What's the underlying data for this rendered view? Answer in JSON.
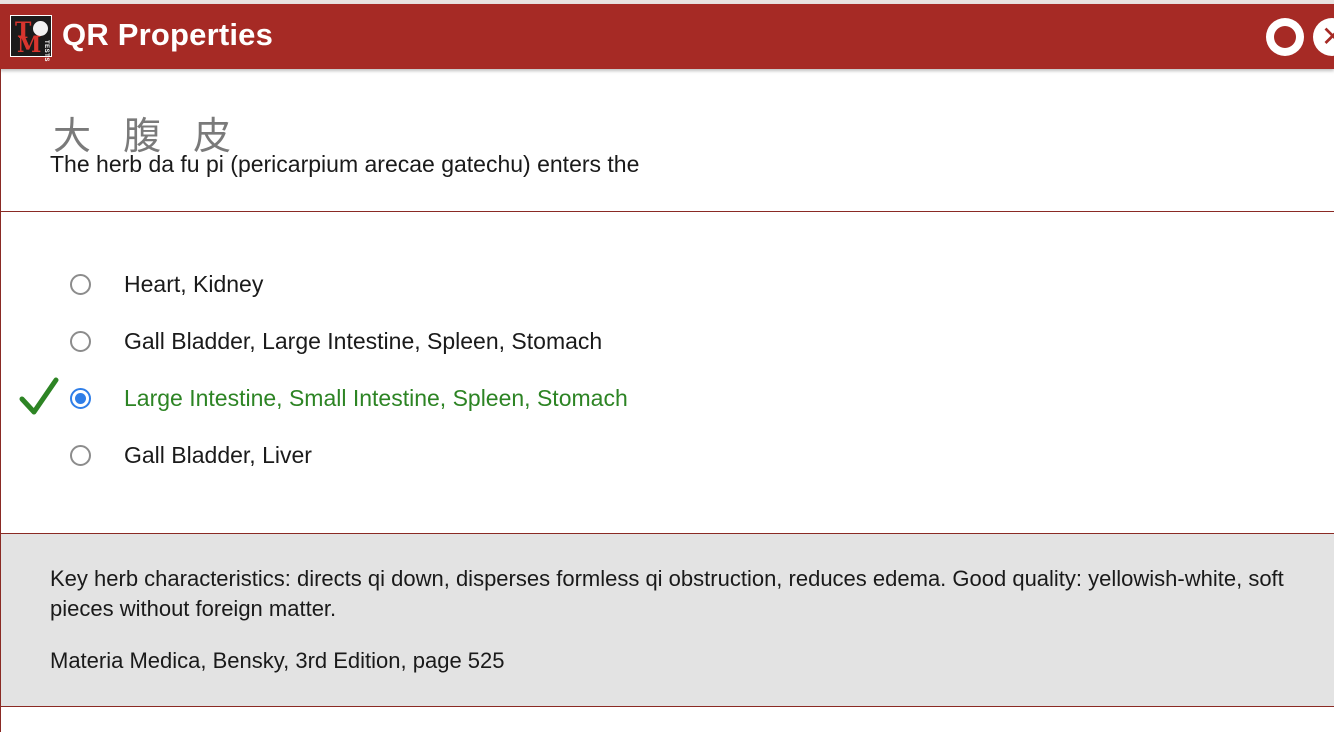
{
  "window": {
    "title": "QR Properties",
    "logo_text_top": "T",
    "logo_text_bottom": "M",
    "logo_text_side": "TESTS",
    "accent_color": "#a62a25"
  },
  "question": {
    "chinese_characters": "大 腹 皮",
    "prompt": "The herb da fu pi (pericarpium arecae gatechu) enters the"
  },
  "answers": [
    {
      "label": "Heart, Kidney",
      "selected": false,
      "correct": false
    },
    {
      "label": "Gall Bladder, Large Intestine, Spleen, Stomach",
      "selected": false,
      "correct": false
    },
    {
      "label": "Large Intestine, Small Intestine, Spleen, Stomach",
      "selected": true,
      "correct": true
    },
    {
      "label": "Gall Bladder, Liver",
      "selected": false,
      "correct": false
    }
  ],
  "explanation": {
    "text": "Key herb characteristics: directs qi down, disperses formless qi obstruction, reduces edema. Good quality: yellowish-white, soft pieces without foreign matter.",
    "reference": "Materia Medica, Bensky, 3rd Edition, page 525"
  },
  "colors": {
    "correct_green": "#2d8424",
    "radio_selected_blue": "#2f7ee8"
  }
}
